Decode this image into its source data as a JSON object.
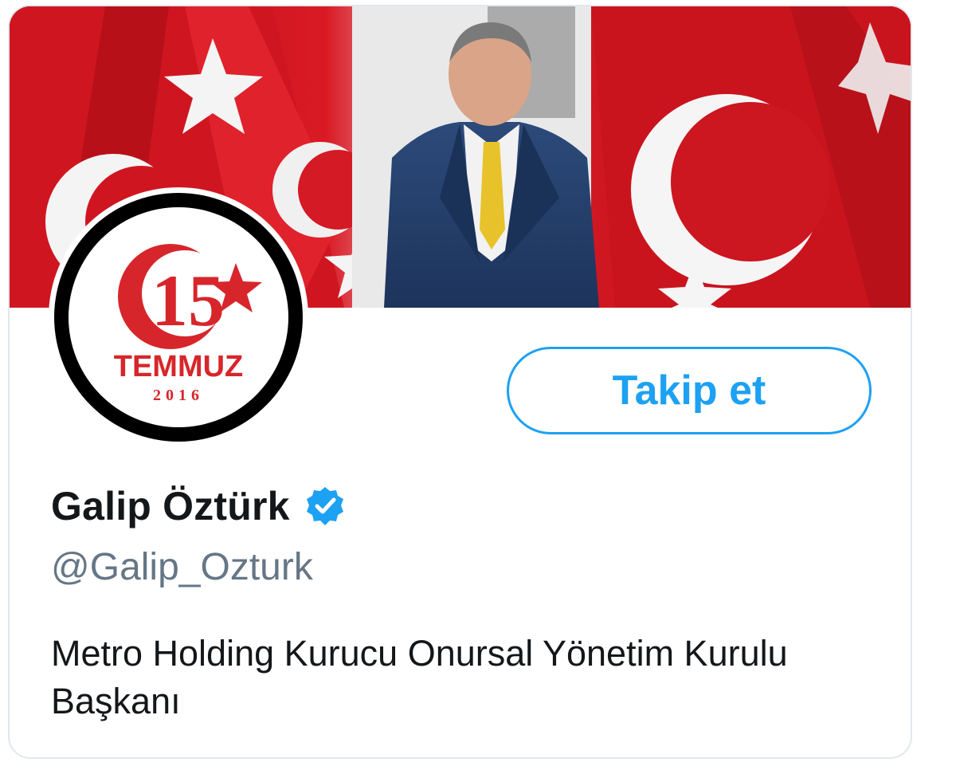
{
  "profile": {
    "display_name": "Galip Öztürk",
    "handle": "@Galip_Ozturk",
    "bio": "Metro Holding Kurucu Onursal Yönetim Kurulu Başkanı",
    "verified": true
  },
  "actions": {
    "follow_label": "Takip et"
  },
  "avatar": {
    "logo_number": "15",
    "logo_text": "TEMMUZ",
    "logo_year": "2016"
  },
  "colors": {
    "accent": "#1da1f2",
    "flag_red": "#c8141e",
    "name_text": "#14171a",
    "handle_text": "#657786"
  },
  "icons": {
    "verified": "verified-badge-icon"
  }
}
